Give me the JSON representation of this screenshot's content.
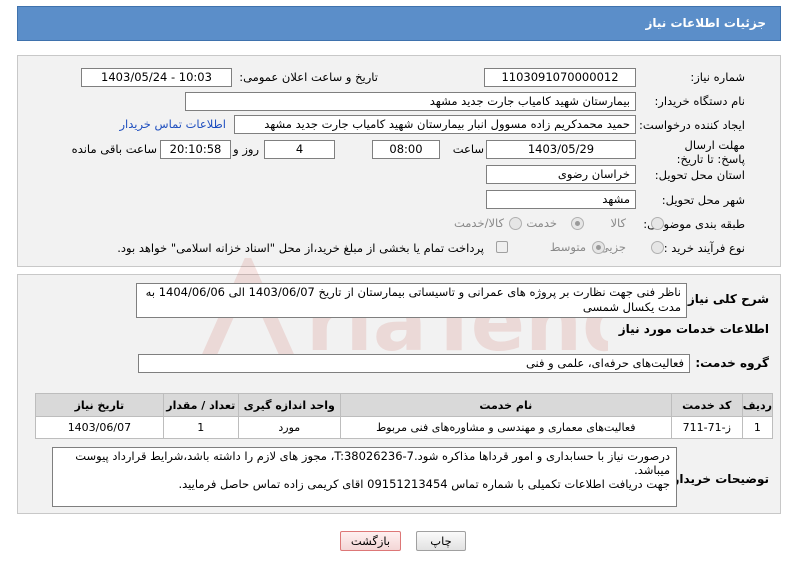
{
  "header": {
    "title": "جزئیات اطلاعات نیاز"
  },
  "form": {
    "need_number_label": "شماره نیاز:",
    "need_number": "1103091070000012",
    "announce_label": "تاریخ و ساعت اعلان عمومی:",
    "announce_value": "1403/05/24 - 10:03",
    "buyer_org_label": "نام دستگاه خریدار:",
    "buyer_org": "بیمارستان شهید کامیاب جارت جدید مشهد",
    "creator_label": "ایجاد کننده درخواست:",
    "creator": "حمید محمدکریم زاده مسوول انبار بیمارستان شهید کامیاب جارت جدید مشهد",
    "buyer_contact_link": "اطلاعات تماس خریدار",
    "deadline_label": "مهلت ارسال پاسخ: تا تاریخ:",
    "deadline_date": "1403/05/29",
    "time_label": "ساعت",
    "deadline_time": "08:00",
    "days_value": "4",
    "days_label": "روز و",
    "remaining_time": "20:10:58",
    "remaining_label": "ساعت باقی مانده",
    "province_label": "استان محل تحویل:",
    "province": "خراسان رضوی",
    "city_label": "شهر محل تحویل:",
    "city": "مشهد",
    "category_label": "طبقه بندی موضوعی:",
    "category_options": [
      "کالا",
      "خدمت",
      "کالا/خدمت"
    ],
    "category_selected": "خدمت",
    "process_label": "نوع فرآیند خرید :",
    "process_options": [
      "جزیی",
      "متوسط"
    ],
    "process_selected": "جزیی",
    "payment_note": "پرداخت تمام یا بخشی از مبلغ خرید،از محل \"اسناد خزانه اسلامی\" خواهد بود."
  },
  "details": {
    "desc_label": "شرح کلی نیاز:",
    "desc": "ناظر فنی جهت نظارت بر پروژه های عمرانی و تاسیساتی بیمارستان از تاریخ 1403/06/07 الی 1404/06/06 به مدت یکسال شمسی",
    "services_title": "اطلاعات خدمات مورد نیاز",
    "group_label": "گروه خدمت:",
    "group_value": "فعالیت‌های حرفه‌ای، علمی و فنی",
    "table": {
      "headers": [
        "ردیف",
        "کد خدمت",
        "نام خدمت",
        "واحد اندازه گیری",
        "تعداد / مقدار",
        "تاریخ نیاز"
      ],
      "rows": [
        [
          "1",
          "ز-71-711",
          "فعالیت‌های معماری و مهندسی و مشاوره‌های فنی مربوط",
          "مورد",
          "1",
          "1403/06/07"
        ]
      ]
    },
    "buyer_notes_label": "توضیحات خریدار:",
    "buyer_notes_1": "درصورت نیاز با حسابداری و امور قرداها مذاکره شود.T:38026236-7، مجوز های لازم را داشته باشد،شرایط قرارداد پیوست میباشد.",
    "buyer_notes_2": "جهت دریافت اطلاعات تکمیلی با شماره تماس 09151213454 اقای کریمی زاده تماس حاصل فرمایید."
  },
  "buttons": {
    "print": "چاپ",
    "back": "بازگشت"
  },
  "watermark": "AriaTender.neT",
  "colors": {
    "header_bg": "#5b8ec9",
    "section_bg": "#f2f2f2",
    "link": "#1f4fbf",
    "watermark": "#c0392b"
  }
}
